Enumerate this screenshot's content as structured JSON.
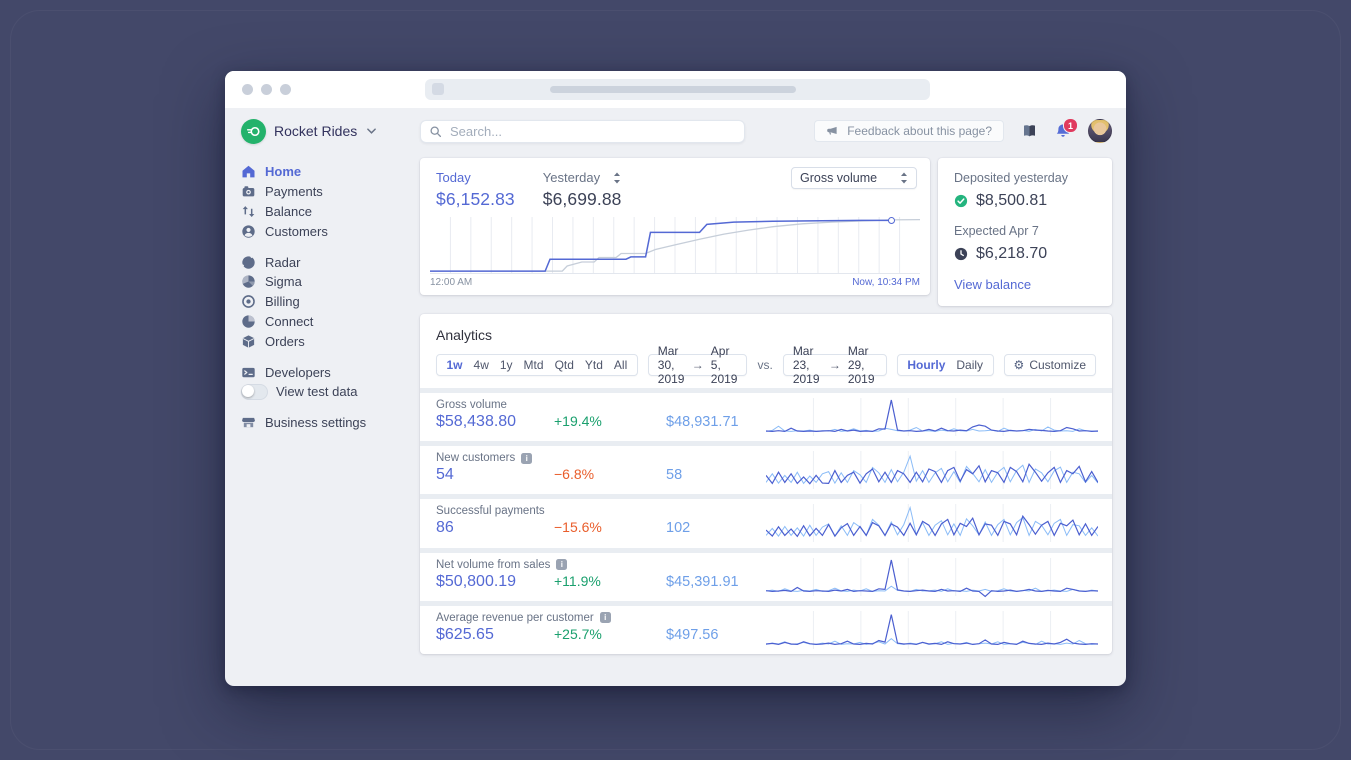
{
  "brand": {
    "name": "Rocket Rides",
    "logo_color": "#23b26b"
  },
  "search": {
    "placeholder": "Search..."
  },
  "topbar": {
    "feedback_label": "Feedback about this page?",
    "notification_count": "1"
  },
  "sidebar": {
    "groups": [
      {
        "items": [
          {
            "label": "Home",
            "icon": "home",
            "active": true
          },
          {
            "label": "Payments",
            "icon": "payments"
          },
          {
            "label": "Balance",
            "icon": "balance"
          },
          {
            "label": "Customers",
            "icon": "customers"
          }
        ]
      },
      {
        "items": [
          {
            "label": "Radar",
            "icon": "radar"
          },
          {
            "label": "Sigma",
            "icon": "sigma"
          },
          {
            "label": "Billing",
            "icon": "billing"
          },
          {
            "label": "Connect",
            "icon": "connect"
          },
          {
            "label": "Orders",
            "icon": "orders"
          }
        ]
      },
      {
        "items": [
          {
            "label": "Developers",
            "icon": "developers"
          },
          {
            "label": "View test data",
            "icon": "toggle",
            "toggle": true
          }
        ]
      },
      {
        "items": [
          {
            "label": "Business settings",
            "icon": "business"
          }
        ]
      }
    ]
  },
  "overview": {
    "today_label": "Today",
    "today_value": "$6,152.83",
    "yesterday_label": "Yesterday",
    "yesterday_value": "$6,699.88",
    "metric_select": "Gross volume",
    "x_start_label": "12:00 AM",
    "x_end_label": "Now, 10:34 PM",
    "chart_data": {
      "type": "line",
      "x_axis": "hour of day (12:00 AM to now, 10:34 PM)",
      "gridline_count": 24,
      "series": [
        {
          "name": "Today",
          "color": "#5469d4",
          "points": [
            [
              0,
              95
            ],
            [
              23.5,
              95
            ],
            [
              24.5,
              74
            ],
            [
              40,
              74
            ],
            [
              41,
              70
            ],
            [
              44,
              70
            ],
            [
              45,
              27
            ],
            [
              55,
              27
            ],
            [
              56.5,
              13
            ],
            [
              62,
              9
            ],
            [
              70,
              7.5
            ],
            [
              80,
              6.5
            ],
            [
              88,
              6
            ],
            [
              94,
              6
            ]
          ]
        },
        {
          "name": "Yesterday",
          "color": "#c6ced9",
          "points": [
            [
              0,
              95
            ],
            [
              27,
              95
            ],
            [
              28,
              86
            ],
            [
              31,
              79
            ],
            [
              33.5,
              79
            ],
            [
              34.5,
              71
            ],
            [
              38,
              71
            ],
            [
              39,
              64
            ],
            [
              44,
              64
            ],
            [
              46,
              57
            ],
            [
              50,
              49
            ],
            [
              55,
              39
            ],
            [
              60,
              30
            ],
            [
              65,
              23
            ],
            [
              70,
              17
            ],
            [
              76,
              12
            ],
            [
              82,
              9
            ],
            [
              88,
              7
            ],
            [
              94,
              5
            ],
            [
              100,
              4.5
            ]
          ]
        }
      ]
    }
  },
  "balance_card": {
    "deposited_label": "Deposited yesterday",
    "deposited_value": "$8,500.81",
    "expected_label": "Expected Apr 7",
    "expected_value": "$6,218.70",
    "link_label": "View balance"
  },
  "analytics": {
    "title": "Analytics",
    "range_tabs": [
      "1w",
      "4w",
      "1y",
      "Mtd",
      "Qtd",
      "Ytd",
      "All"
    ],
    "active_range": "1w",
    "arrow": "→",
    "date_range": {
      "start": "Mar 30, 2019",
      "end": "Apr 5, 2019"
    },
    "vs_label": "vs.",
    "compare_range": {
      "start": "Mar 23, 2019",
      "end": "Mar 29, 2019"
    },
    "granularity_tabs": [
      "Hourly",
      "Daily"
    ],
    "active_granularity": "Hourly",
    "customize_label": "Customize",
    "spark_day_sections": 7,
    "rows": [
      {
        "label": "Gross volume",
        "info": false,
        "value": "$58,438.80",
        "delta": "+19.4%",
        "delta_dir": "up",
        "compare": "$48,931.71",
        "spark": {
          "current": [
            3,
            2,
            4,
            2,
            12,
            3,
            2,
            3,
            2,
            3,
            4,
            2,
            8,
            3,
            6,
            2,
            3,
            2,
            10,
            9,
            100,
            6,
            3,
            4,
            2,
            3,
            8,
            3,
            12,
            4,
            3,
            6,
            4,
            16,
            22,
            18,
            6,
            3,
            2,
            5,
            3,
            4,
            8,
            6,
            5,
            3,
            2,
            4,
            14,
            10,
            3,
            4,
            2,
            3
          ],
          "previous": [
            2,
            5,
            18,
            3,
            2,
            4,
            3,
            6,
            2,
            4,
            3,
            8,
            2,
            4,
            10,
            3,
            5,
            2,
            3,
            12,
            8,
            4,
            3,
            6,
            14,
            3,
            4,
            2,
            6,
            3,
            10,
            4,
            3,
            8,
            3,
            4,
            6,
            2,
            12,
            4,
            3,
            5,
            2,
            8,
            3,
            16,
            6,
            3,
            4,
            2,
            10,
            4,
            3,
            2
          ]
        }
      },
      {
        "label": "New customers",
        "info": true,
        "value": "54",
        "delta": "−6.8%",
        "delta_dir": "down",
        "compare": "58",
        "spark": {
          "current": [
            30,
            5,
            40,
            8,
            35,
            5,
            25,
            4,
            30,
            6,
            5,
            45,
            8,
            30,
            40,
            6,
            35,
            50,
            10,
            40,
            8,
            45,
            35,
            8,
            40,
            10,
            50,
            42,
            8,
            45,
            55,
            12,
            48,
            35,
            60,
            10,
            45,
            38,
            8,
            55,
            42,
            10,
            65,
            40,
            12,
            38,
            55,
            8,
            45,
            35,
            58,
            10,
            42,
            8
          ],
          "previous": [
            8,
            35,
            6,
            30,
            8,
            40,
            5,
            28,
            8,
            35,
            42,
            6,
            38,
            8,
            45,
            32,
            8,
            55,
            38,
            8,
            48,
            10,
            40,
            90,
            12,
            45,
            8,
            38,
            52,
            10,
            42,
            8,
            58,
            36,
            10,
            48,
            8,
            40,
            55,
            10,
            45,
            62,
            8,
            50,
            38,
            10,
            44,
            56,
            8,
            40,
            35,
            8,
            30,
            6
          ]
        }
      },
      {
        "label": "Successful payments",
        "info": false,
        "value": "86",
        "delta": "−15.6%",
        "delta_dir": "down",
        "compare": "102",
        "spark": {
          "current": [
            25,
            6,
            35,
            8,
            28,
            5,
            38,
            7,
            30,
            8,
            42,
            6,
            32,
            45,
            8,
            36,
            8,
            48,
            38,
            8,
            44,
            34,
            8,
            46,
            10,
            52,
            40,
            8,
            44,
            58,
            10,
            46,
            36,
            62,
            10,
            44,
            40,
            8,
            52,
            44,
            10,
            68,
            42,
            12,
            40,
            52,
            8,
            46,
            38,
            56,
            10,
            44,
            8,
            36
          ],
          "previous": [
            8,
            30,
            6,
            36,
            8,
            32,
            6,
            40,
            8,
            34,
            44,
            6,
            38,
            8,
            48,
            34,
            8,
            58,
            40,
            8,
            50,
            10,
            42,
            95,
            10,
            48,
            8,
            40,
            54,
            10,
            44,
            8,
            60,
            38,
            10,
            50,
            8,
            42,
            58,
            10,
            48,
            64,
            8,
            52,
            40,
            10,
            46,
            58,
            8,
            42,
            38,
            8,
            32,
            6
          ]
        }
      },
      {
        "label": "Net volume from sales",
        "info": true,
        "value": "$50,800.19",
        "delta": "+11.9%",
        "delta_dir": "up",
        "compare": "$45,391.91",
        "spark": {
          "current": [
            4,
            2,
            3,
            5,
            2,
            14,
            3,
            2,
            4,
            3,
            2,
            6,
            3,
            8,
            2,
            4,
            3,
            2,
            10,
            8,
            100,
            7,
            3,
            2,
            4,
            6,
            3,
            2,
            8,
            3,
            4,
            2,
            12,
            3,
            2,
            -14,
            4,
            2,
            3,
            6,
            2,
            4,
            8,
            3,
            2,
            5,
            3,
            2,
            12,
            8,
            3,
            2,
            4,
            3
          ],
          "previous": [
            3,
            6,
            2,
            10,
            3,
            2,
            5,
            3,
            8,
            2,
            4,
            12,
            3,
            2,
            6,
            3,
            10,
            2,
            4,
            3,
            18,
            5,
            3,
            2,
            8,
            3,
            4,
            6,
            2,
            10,
            3,
            4,
            2,
            6,
            3,
            8,
            2,
            4,
            10,
            3,
            2,
            5,
            3,
            12,
            2,
            4,
            6,
            3,
            2,
            8,
            4,
            2,
            6,
            3
          ]
        }
      },
      {
        "label": "Average revenue per customer",
        "info": true,
        "value": "$625.65",
        "delta": "+25.7%",
        "delta_dir": "up",
        "compare": "$497.56",
        "spark": {
          "current": [
            3,
            5,
            2,
            8,
            3,
            2,
            10,
            4,
            2,
            3,
            6,
            2,
            4,
            12,
            3,
            2,
            5,
            3,
            14,
            9,
            95,
            6,
            3,
            4,
            2,
            8,
            3,
            5,
            2,
            10,
            4,
            3,
            6,
            2,
            4,
            16,
            3,
            2,
            8,
            4,
            2,
            12,
            5,
            3,
            2,
            6,
            3,
            8,
            18,
            6,
            3,
            2,
            4,
            3
          ],
          "previous": [
            2,
            6,
            3,
            10,
            2,
            4,
            8,
            3,
            2,
            6,
            3,
            12,
            2,
            4,
            3,
            8,
            2,
            5,
            10,
            3,
            20,
            4,
            2,
            6,
            3,
            8,
            2,
            4,
            10,
            2,
            5,
            3,
            8,
            2,
            4,
            6,
            3,
            10,
            2,
            4,
            3,
            8,
            5,
            2,
            12,
            3,
            4,
            2,
            6,
            3,
            14,
            4,
            2,
            3
          ]
        }
      }
    ]
  },
  "colors": {
    "accent": "#5469d4",
    "positive": "#1ba06e",
    "negative": "#e95e2c",
    "compare_value": "#6e9fe8",
    "spark_current": "#4b5fd0",
    "spark_previous": "#8bbcf7",
    "yesterday_line": "#c6ced9",
    "badge_red": "#e03a5e",
    "logo_green": "#23b26b"
  }
}
